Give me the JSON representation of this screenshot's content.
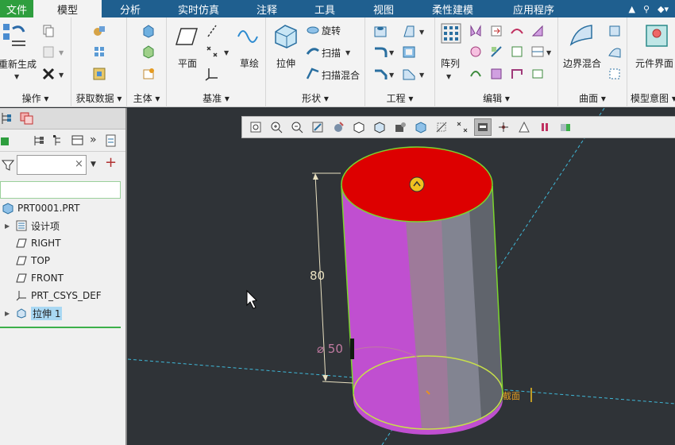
{
  "menu": {
    "tabs": [
      "文件",
      "模型",
      "分析",
      "实时仿真",
      "注释",
      "工具",
      "视图",
      "柔性建模",
      "应用程序"
    ],
    "active": "模型"
  },
  "ribbon": {
    "groups": [
      "操作",
      "获取数据",
      "主体",
      "基准",
      "形状",
      "工程",
      "编辑",
      "曲面",
      "模型意图"
    ],
    "buttons": {
      "regenerate": "重新生成",
      "plane": "平面",
      "sketch": "草绘",
      "extrude": "拉伸",
      "revolve": "旋转",
      "sweep": "扫描",
      "swept_blend": "扫描混合",
      "pattern": "阵列",
      "boundary_blend": "边界混合",
      "component_interface": "元件界面"
    }
  },
  "model_tree": {
    "root": "PRT0001.PRT",
    "items": [
      "设计项",
      "RIGHT",
      "TOP",
      "FRONT",
      "PRT_CSYS_DEF",
      "拉伸 1"
    ],
    "filter_placeholder": ""
  },
  "viewport": {
    "dimension_height": "80",
    "dimension_diameter": "⌀ 50",
    "section_label": "截面",
    "colors": {
      "top_face": "#dd0000",
      "side_face": "#c04fd0",
      "edge": "#7bd62e",
      "background": "#2f3337"
    }
  }
}
